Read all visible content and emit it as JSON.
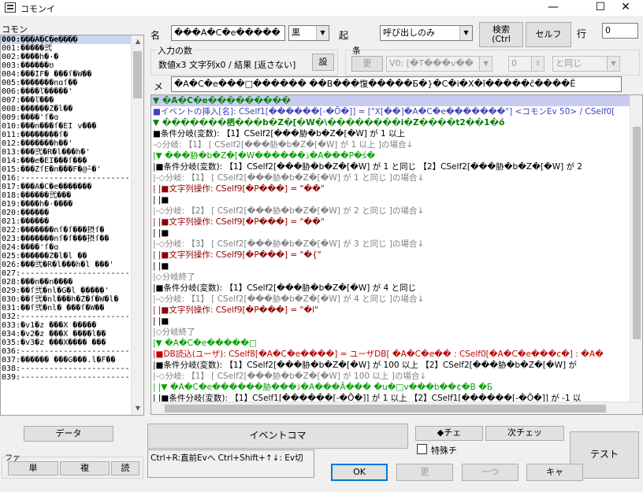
{
  "window": {
    "title": "コモンイ",
    "minimize": "—",
    "maximize": "☐",
    "close": "✕"
  },
  "sidebar": {
    "label": "コモン",
    "items": [
      "000:���A�C�e����",
      "001:�����弐",
      "002:����h�·�",
      "003:������ʊ",
      "004:���ÍF�  ���ſ�W��",
      "005:�������nɑſ��",
      "006:����ľ�����'",
      "007:���ľ���",
      "008:������Ž�l��",
      "009:����'ſ�ɑ",
      "010:���n���ſ�EI v���",
      "011:��������ſ�",
      "012:�������h��'",
      "013:���弐�R�l���h�'",
      "014:���e�ĖI���ſ���",
      "015:���ŽſĖ�n���F�@̃~�'",
      "016:------------------------------",
      "017:���A�C�e�������",
      "018:������弐���",
      "019:����h�·����",
      "020:������",
      "021:������",
      "022:�������nſ�ſ���摂ſ�",
      "023:�������nſ�ſ���摂ſ��",
      "024:����'ſ�ɑ",
      "025:������Ž�l�l ��",
      "026:���弐�R�l���h�l ���'",
      "027:------------------------------",
      "028:���n��n����",
      "029:��ſ弐�nl�G�l �����'",
      "030:��ſ弐�nl���h�Ž�ſ�W�l�",
      "031:��ſ弐�nl�  ���ſ�W��",
      "032:------------------------------",
      "033:�v1�z ���X �����",
      "034:�v2�z ���X ����l��",
      "035:�v3�z ���X���� ���",
      "036:------------------------------",
      "037:������  ���G���.l�F��",
      "038:------------------------------",
      "039:------------------------------"
    ],
    "data_button": "データ",
    "footer_label": "ファ",
    "single_button": "単",
    "multi_button": "複",
    "read_button": "読"
  },
  "header": {
    "name_label": "名",
    "name_value": "���A�C�e�����",
    "color_value": "黒",
    "trigger_label": "起",
    "trigger_value": "呼び出しのみ",
    "search_button": "検索\n(Ctrl",
    "self_button": "セルフ",
    "row_label": "行",
    "row_value": "0"
  },
  "input_group": {
    "title": "入力の数",
    "summary": "数値x3 文字列x0 / 結果 [返さない]",
    "set_button": "設"
  },
  "cond_group": {
    "title": "条",
    "update_button": "更",
    "v0_value": "V0: [�T���v��",
    "num_value": "0",
    "cmp_value": "と同じ"
  },
  "memo": {
    "label": "メ",
    "value": "�A�C�e���□������ ��B���愎�����Б�}�C�i�X�ǐ�����ĉ����Ẽ"
  },
  "editor": {
    "lines": [
      {
        "t": "▼ �A�C�e���������",
        "c": "c-green",
        "hl": true
      },
      {
        "t": "■イベントの挿入[名]: CSelf1[������[-�Õ�]] = [\"X[��]�A�C�e�������\"] <コモンEv 50> / CSelf0[",
        "c": "c-blue"
      },
      {
        "t": "▼ �������栖���b�Z�[�W�\\��������i�Z����t2��1�ő",
        "c": "c-green"
      },
      {
        "t": "■条件分岐(変数): 【1】CSelf2[���胁�b�Z�[�W]  が   1 以上",
        "c": "c-black"
      },
      {
        "t": "-◇分岐: 【1】 [ CSelf2[���胁�b�Z�[�W] が 1 以上 ]の場合↓",
        "c": "c-gray"
      },
      {
        "t": "|▼ ���胁�b�Z�[�W������ڎ�A���P�ś�",
        "c": "c-green2"
      },
      {
        "t": "|■条件分岐(変数): 【1】CSelf2[���胁�b�Z�[�W]  が   1 と同じ 【2】CSelf2[���胁�b�Z�[�W]  が   2",
        "c": "c-black"
      },
      {
        "t": "|-◇分岐: 【1】 [ CSelf2[���胁�b�Z�[�W] が 1 と同じ ]の場合↓",
        "c": "c-gray"
      },
      {
        "t": "| |■文字列操作: CSelf9[�P���] = \"��\"",
        "c": "c-red2"
      },
      {
        "t": "| |■",
        "c": "c-black"
      },
      {
        "t": "|-◇分岐: 【2】 [ CSelf2[���胁�b�Z�[�W] が 2 と同じ ]の場合↓",
        "c": "c-gray"
      },
      {
        "t": "| |■文字列操作: CSelf9[�P���] = \"��\"",
        "c": "c-red2"
      },
      {
        "t": "| |■",
        "c": "c-black"
      },
      {
        "t": "|-◇分岐: 【3】 [ CSelf2[���胁�b�Z�[�W] が 3 と同じ ]の場合↓",
        "c": "c-gray"
      },
      {
        "t": "| |■文字列操作: CSelf9[�P���] = \"�{\"",
        "c": "c-red2"
      },
      {
        "t": "| |■",
        "c": "c-black"
      },
      {
        "t": "|◇分岐終了",
        "c": "c-gray"
      },
      {
        "t": "|■条件分岐(変数): 【1】CSelf2[���胁�b�Z�[�W]  が   4 と同じ",
        "c": "c-black"
      },
      {
        "t": "|-◇分岐: 【1】 [ CSelf2[���胁�b�Z�[�W] が 4 と同じ ]の場合↓",
        "c": "c-gray"
      },
      {
        "t": "| |■文字列操作: CSelf9[�P���] = \"�l\"",
        "c": "c-red2"
      },
      {
        "t": "| |■",
        "c": "c-black"
      },
      {
        "t": "|◇分岐終了",
        "c": "c-gray"
      },
      {
        "t": "|▼ �A�C�e�����□",
        "c": "c-green2"
      },
      {
        "t": "|■DB読込(ユーザ): CSelf8[�A�C�e����] = ユーザDB[ �A�C�e�� : CSelf0[�A�C�e���c�] : �A�",
        "c": "c-red"
      },
      {
        "t": "|■条件分岐(変数): 【1】CSelf2[���胁�b�Z�[�W]  が   100 以上 【2】CSelf2[���胁�b�Z�[�W]  が",
        "c": "c-black"
      },
      {
        "t": "|-◇分岐: 【1】 [ CSelf2[���胁�b�Z�[�W] が 100 以上 ]の場合↓",
        "c": "c-gray"
      },
      {
        "t": "| |▼ �A�C�e������胁���ڎ�A���Ã���    �u�□v���b��¢�B    �Б",
        "c": "c-green2"
      },
      {
        "t": "| |■条件分岐(変数): 【1】CSelf1[������[-�Õ�]]  が   1 以上 【2】CSelf1[������[-�Õ�]]  が   -1 以",
        "c": "c-black"
      }
    ]
  },
  "bottom": {
    "event_button": "イベントコマ",
    "check_button": "◆チェ",
    "next_check_button": "次チェッ",
    "special_label": "特殊チ",
    "test_button": "テスト",
    "hint_text": "Ctrl+R:直前Evへ   Ctrl+Shift+↑↓: Ev切",
    "ok_button": "OK",
    "update_button": "更",
    "prev_button": "一つ",
    "cancel_button": "キャ"
  }
}
